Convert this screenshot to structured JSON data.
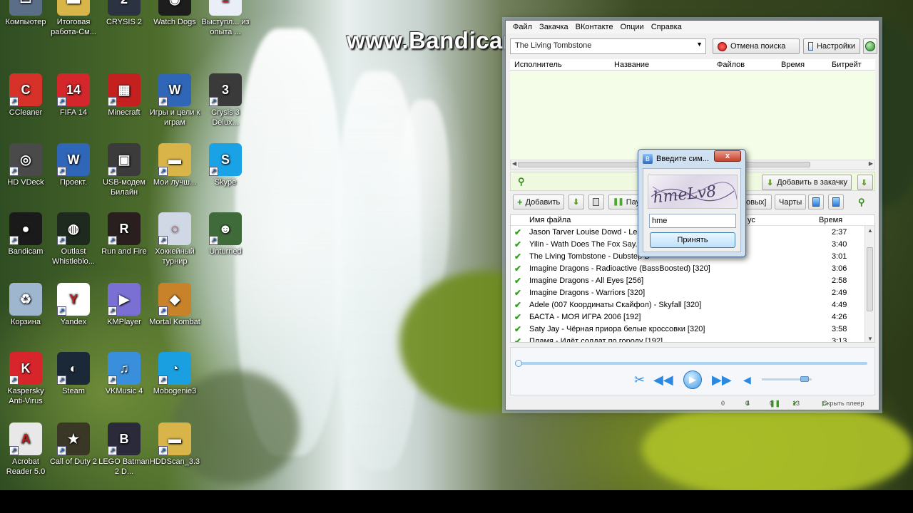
{
  "watermark": "www.Bandicam.com",
  "desktop_icons": [
    {
      "label": "Компьютер",
      "icon": "computer-icon",
      "color": "#5a6e88"
    },
    {
      "label": "Итоговая работа-См...",
      "icon": "folder-icon",
      "color": "#d9b449"
    },
    {
      "label": "CRYSIS 2",
      "icon": "crysis2-icon",
      "color": "#2b3342"
    },
    {
      "label": "Watch Dogs",
      "icon": "watchdogs-icon",
      "color": "#1d1d1d"
    },
    {
      "label": "Выступл... из опыта ...",
      "icon": "document-icon",
      "color": "#e9eef7"
    },
    {
      "label": "CCleaner",
      "icon": "ccleaner-icon",
      "color": "#d6322a"
    },
    {
      "label": "FIFA 14",
      "icon": "fifa-icon",
      "color": "#d3272b"
    },
    {
      "label": "Minecraft",
      "icon": "minecraft-icon",
      "color": "#c52020"
    },
    {
      "label": "Игры и цели к играм",
      "icon": "word-document-icon",
      "color": "#2f66b8"
    },
    {
      "label": "Crysis 3 Delux...",
      "icon": "crysis3-icon",
      "color": "#3a3a3a"
    },
    {
      "label": "HD VDeck",
      "icon": "hdvdeck-icon",
      "color": "#4a4a4a"
    },
    {
      "label": "Проект.",
      "icon": "word-document-icon",
      "color": "#2f66b8"
    },
    {
      "label": "USB-модем Билайн",
      "icon": "usb-modem-icon",
      "color": "#3b3b3b"
    },
    {
      "label": "Мои лучш...",
      "icon": "folder-icon",
      "color": "#d9b449"
    },
    {
      "label": "Skype",
      "icon": "skype-icon",
      "color": "#19a3e6"
    },
    {
      "label": "Bandicam",
      "icon": "bandicam-icon",
      "color": "#1a1a1a"
    },
    {
      "label": "Outlast Whistleblo...",
      "icon": "outlast-icon",
      "color": "#1e2a1e"
    },
    {
      "label": "Run and Fire",
      "icon": "runandfire-icon",
      "color": "#2a1f1f"
    },
    {
      "label": "Хоккейный турнир",
      "icon": "sochi-icon",
      "color": "#cfd8e4"
    },
    {
      "label": "Unturned",
      "icon": "unturned-icon",
      "color": "#3f6a3a"
    },
    {
      "label": "Корзина",
      "icon": "recycle-bin-icon",
      "color": "#9fb6cf"
    },
    {
      "label": "Yandex",
      "icon": "yandex-icon",
      "color": "#ffffff"
    },
    {
      "label": "KMPlayer",
      "icon": "kmplayer-icon",
      "color": "#7a6fd3"
    },
    {
      "label": "Mortal Kombat",
      "icon": "mortalkombat-icon",
      "color": "#c8822a"
    },
    {
      "label": "Kaspersky Anti-Virus",
      "icon": "kaspersky-icon",
      "color": "#d8252b"
    },
    {
      "label": "Steam",
      "icon": "steam-icon",
      "color": "#1b2838"
    },
    {
      "label": "VKMusic 4",
      "icon": "vkmusic-icon",
      "color": "#3a8fdc"
    },
    {
      "label": "Mobogenie3",
      "icon": "mobogenie-icon",
      "color": "#1aa0e0"
    },
    {
      "label": "Acrobat Reader 5.0",
      "icon": "acrobat-icon",
      "color": "#e8e8e8"
    },
    {
      "label": "Call of Duty 2",
      "icon": "callofduty-icon",
      "color": "#3b3727"
    },
    {
      "label": "LEGO Batman 2 D...",
      "icon": "legobatman-icon",
      "color": "#2a2a3a"
    },
    {
      "label": "HDDScan_3.3",
      "icon": "folder-icon",
      "color": "#d9b449"
    }
  ],
  "app": {
    "menu": [
      "Файл",
      "Закачка",
      "ВКонтакте",
      "Опции",
      "Справка"
    ],
    "search_value": "The Living Tombstone",
    "cancel_search": "Отмена поиска",
    "settings": "Настройки",
    "results_columns": [
      "Исполнитель",
      "Название",
      "Файлов",
      "Время",
      "Битрейт"
    ],
    "add_to_download": "Добавить в закачку",
    "toolbar": {
      "add": "Добавить",
      "pause": "Пауз",
      "new_suffix": "овых]",
      "charts": "Чарты"
    },
    "file_columns": {
      "name": "Имя файла",
      "status": "ус",
      "time": "Время"
    },
    "files": [
      {
        "name": "Jason Tarver  Louise Dowd - Leap",
        "time": "2:37"
      },
      {
        "name": "Yilin - Wath Does The Fox Say.mp3",
        "time": "3:40"
      },
      {
        "name": "The Living Tombstone - Dubstep D",
        "time": "3:01"
      },
      {
        "name": "Imagine Dragons - Radioactive (BassBoosted) [320]",
        "time": "3:06"
      },
      {
        "name": "Imagine Dragons - All Eyes [256]",
        "time": "2:58"
      },
      {
        "name": "Imagine Dragons - Warriors [320]",
        "time": "2:49"
      },
      {
        "name": "Adele (007 Координаты Скайфол) - Skyfall [320]",
        "time": "4:49"
      },
      {
        "name": "БАСТА - МОЯ ИГРА 2006 [192]",
        "time": "4:26"
      },
      {
        "name": "Saty Jay - Чёрная приора белые кроссовки [320]",
        "time": "3:58"
      },
      {
        "name": "Пламя - Идёт солдат по городу [192]",
        "time": "3:13"
      }
    ],
    "player": {
      "progress": 0.0,
      "volume": 0.85
    },
    "status": {
      "a": "0",
      "b": "0",
      "c": "0",
      "done": "13",
      "hide_player": "Скрыть плеер"
    }
  },
  "captcha": {
    "title": "Введите сим...",
    "close": "x",
    "image_text": "hmeLv8",
    "input_value": "hme",
    "submit": "Принять"
  }
}
